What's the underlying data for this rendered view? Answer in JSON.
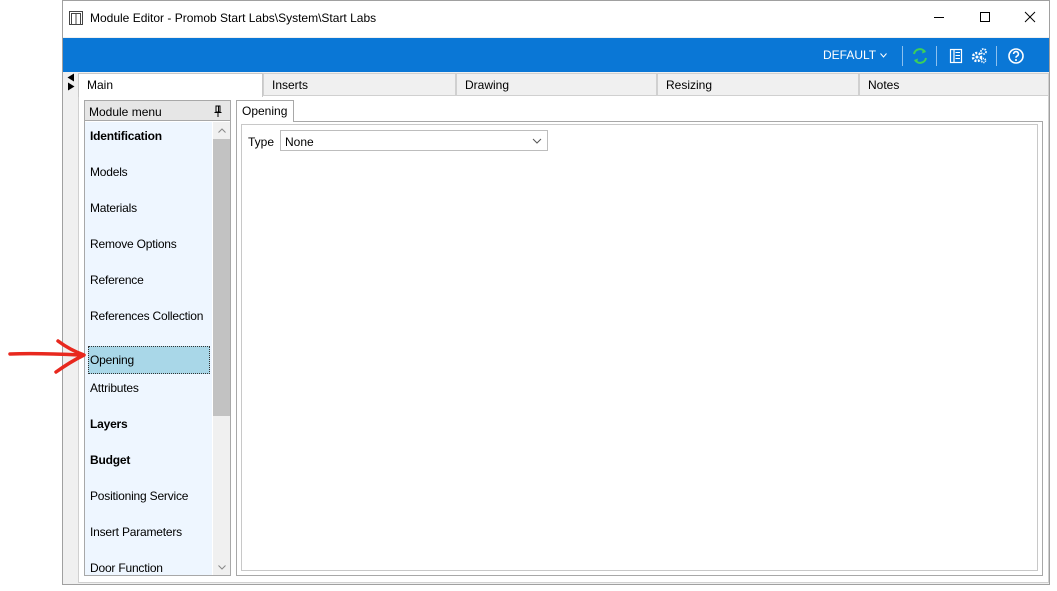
{
  "window": {
    "title": "Module Editor - Promob Start Labs\\System\\Start Labs"
  },
  "ribbon": {
    "profile_label": "DEFAULT",
    "icons": [
      "refresh-icon",
      "catalog-icon",
      "settings-gears-icon",
      "help-icon"
    ]
  },
  "main_tabs": [
    {
      "label": "Main",
      "active": true
    },
    {
      "label": "Inserts",
      "active": false
    },
    {
      "label": "Drawing",
      "active": false
    },
    {
      "label": "Resizing",
      "active": false
    },
    {
      "label": "Notes",
      "active": false
    }
  ],
  "module_menu": {
    "title": "Module menu",
    "items": [
      {
        "label": "Identification",
        "bold": true
      },
      {
        "label": "Models",
        "bold": false
      },
      {
        "label": "Materials",
        "bold": false
      },
      {
        "label": "Remove Options",
        "bold": false
      },
      {
        "label": "Reference",
        "bold": false
      },
      {
        "label": "References Collection",
        "bold": false
      },
      {
        "label": "Opening",
        "bold": false,
        "selected": true
      },
      {
        "label": "Attributes",
        "bold": false
      },
      {
        "label": "Layers",
        "bold": true
      },
      {
        "label": "Budget",
        "bold": true
      },
      {
        "label": "Positioning Service",
        "bold": false
      },
      {
        "label": "Insert Parameters",
        "bold": false
      },
      {
        "label": "Door Function",
        "bold": false
      }
    ]
  },
  "opening_panel": {
    "tab_label": "Opening",
    "type_label": "Type",
    "type_value": "None"
  },
  "colors": {
    "ribbon": "#0a77d6",
    "selected_item": "#a9d7e8",
    "menu_background": "#eef6ff",
    "annotation_arrow": "#e8281e"
  }
}
